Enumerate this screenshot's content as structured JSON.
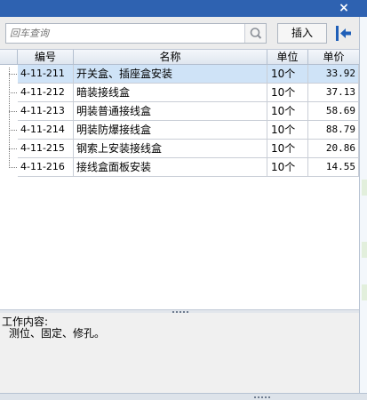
{
  "window": {
    "close_glyph": "×"
  },
  "search": {
    "placeholder": "回车查询"
  },
  "toolbar": {
    "insert_label": "插入"
  },
  "table": {
    "columns": [
      "编号",
      "名称",
      "单位",
      "单价"
    ],
    "rows": [
      {
        "code": "4-11-211",
        "name": "开关盒、插座盒安装",
        "unit": "10个",
        "price": "33.92"
      },
      {
        "code": "4-11-212",
        "name": "暗装接线盒",
        "unit": "10个",
        "price": "37.13"
      },
      {
        "code": "4-11-213",
        "name": "明装普通接线盒",
        "unit": "10个",
        "price": "58.69"
      },
      {
        "code": "4-11-214",
        "name": "明装防爆接线盒",
        "unit": "10个",
        "price": "88.79"
      },
      {
        "code": "4-11-215",
        "name": "钢索上安装接线盒",
        "unit": "10个",
        "price": "20.86"
      },
      {
        "code": "4-11-216",
        "name": "接线盒面板安装",
        "unit": "10个",
        "price": "14.55"
      }
    ],
    "selected_index": 0
  },
  "work": {
    "title": "工作内容:",
    "content": "测位、固定、修孔。"
  },
  "colors": {
    "titlebar": "#2e62b1",
    "selected_row": "#cfe3f7",
    "exit_icon": "#1f5fb8"
  },
  "icons": {
    "search": "search-icon",
    "exit": "exit-icon",
    "close": "close-icon"
  }
}
